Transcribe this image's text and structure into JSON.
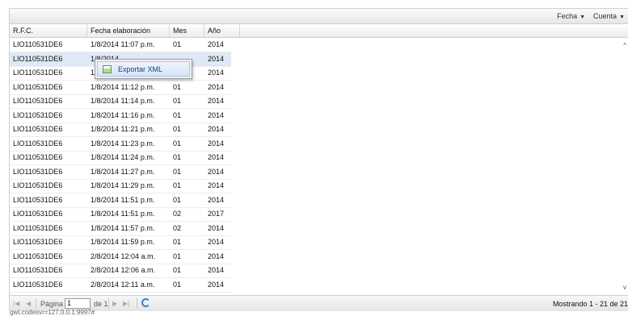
{
  "toolbar": {
    "menus": [
      {
        "label": "Fecha"
      },
      {
        "label": "Cuenta"
      }
    ]
  },
  "grid": {
    "columns": [
      "R.F.C.",
      "Fecha elaboración",
      "Mes",
      "Año"
    ],
    "selected_row": 1,
    "rows": [
      [
        "LIO110531DE6",
        "1/8/2014 11:07 p.m.",
        "01",
        "2014"
      ],
      [
        "LIO110531DE6",
        "1/8/2014",
        "",
        "2014"
      ],
      [
        "LIO110531DE6",
        "1/8/2014",
        "",
        "2014"
      ],
      [
        "LIO110531DE6",
        "1/8/2014 11:12 p.m.",
        "01",
        "2014"
      ],
      [
        "LIO110531DE6",
        "1/8/2014 11:14 p.m.",
        "01",
        "2014"
      ],
      [
        "LIO110531DE6",
        "1/8/2014 11:16 p.m.",
        "01",
        "2014"
      ],
      [
        "LIO110531DE6",
        "1/8/2014 11:21 p.m.",
        "01",
        "2014"
      ],
      [
        "LIO110531DE6",
        "1/8/2014 11:23 p.m.",
        "01",
        "2014"
      ],
      [
        "LIO110531DE6",
        "1/8/2014 11:24 p.m.",
        "01",
        "2014"
      ],
      [
        "LIO110531DE6",
        "1/8/2014 11:27 p.m.",
        "01",
        "2014"
      ],
      [
        "LIO110531DE6",
        "1/8/2014 11:29 p.m.",
        "01",
        "2014"
      ],
      [
        "LIO110531DE6",
        "1/8/2014 11:51 p.m.",
        "01",
        "2014"
      ],
      [
        "LIO110531DE6",
        "1/8/2014 11:51 p.m.",
        "02",
        "2017"
      ],
      [
        "LIO110531DE6",
        "1/8/2014 11:57 p.m.",
        "02",
        "2014"
      ],
      [
        "LIO110531DE6",
        "1/8/2014 11:59 p.m.",
        "01",
        "2014"
      ],
      [
        "LIO110531DE6",
        "2/8/2014 12:04 a.m.",
        "01",
        "2014"
      ],
      [
        "LIO110531DE6",
        "2/8/2014 12:06 a.m.",
        "01",
        "2014"
      ],
      [
        "LIO110531DE6",
        "2/8/2014 12:11 a.m.",
        "01",
        "2014"
      ]
    ]
  },
  "context_menu": {
    "items": [
      {
        "label": "Exportar XML",
        "icon": "spreadsheet-icon"
      }
    ]
  },
  "pager": {
    "page_label": "Página",
    "page_value": "1",
    "of_label": "de 1",
    "display_msg": "Mostrando 1 - 21 de 21"
  },
  "statusbar": {
    "text": "gwt.codesvr=127.0.0.1:9997#"
  },
  "colors": {
    "selected_row": "#dfe8f6",
    "menu_highlight": "#d6e5f7",
    "refresh_icon": "#3a7fc9"
  }
}
